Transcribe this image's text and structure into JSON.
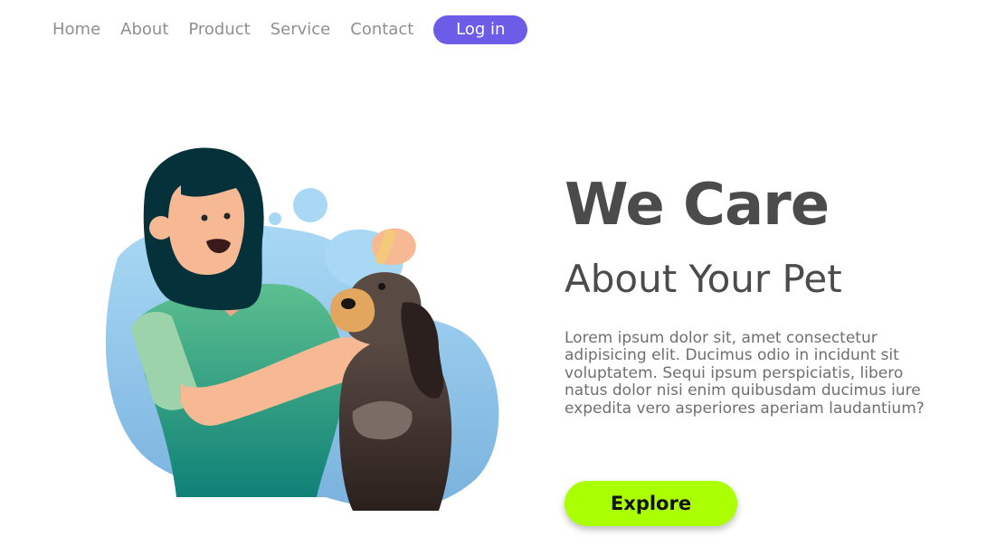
{
  "nav": {
    "links": [
      {
        "label": "Home"
      },
      {
        "label": "About"
      },
      {
        "label": "Product"
      },
      {
        "label": "Service"
      },
      {
        "label": "Contact"
      }
    ],
    "login_label": "Log in"
  },
  "hero": {
    "title": "We Care",
    "subtitle": "About Your Pet",
    "description": "Lorem ipsum dolor sit, amet consectetur adipisicing elit. Ducimus odio in incidunt sit voluptatem. Sequi ipsum perspiciatis, libero natus dolor nisi enim quibusdam ducimus iure expedita vero asperiores aperiam laudantium?",
    "cta_label": "Explore"
  },
  "colors": {
    "accent": "#6c5ce7",
    "cta": "#aaff00",
    "heading": "#4b4b4b",
    "nav_text": "#8f8f8f"
  },
  "illustration": {
    "subject": "woman-with-dog-illustration"
  }
}
